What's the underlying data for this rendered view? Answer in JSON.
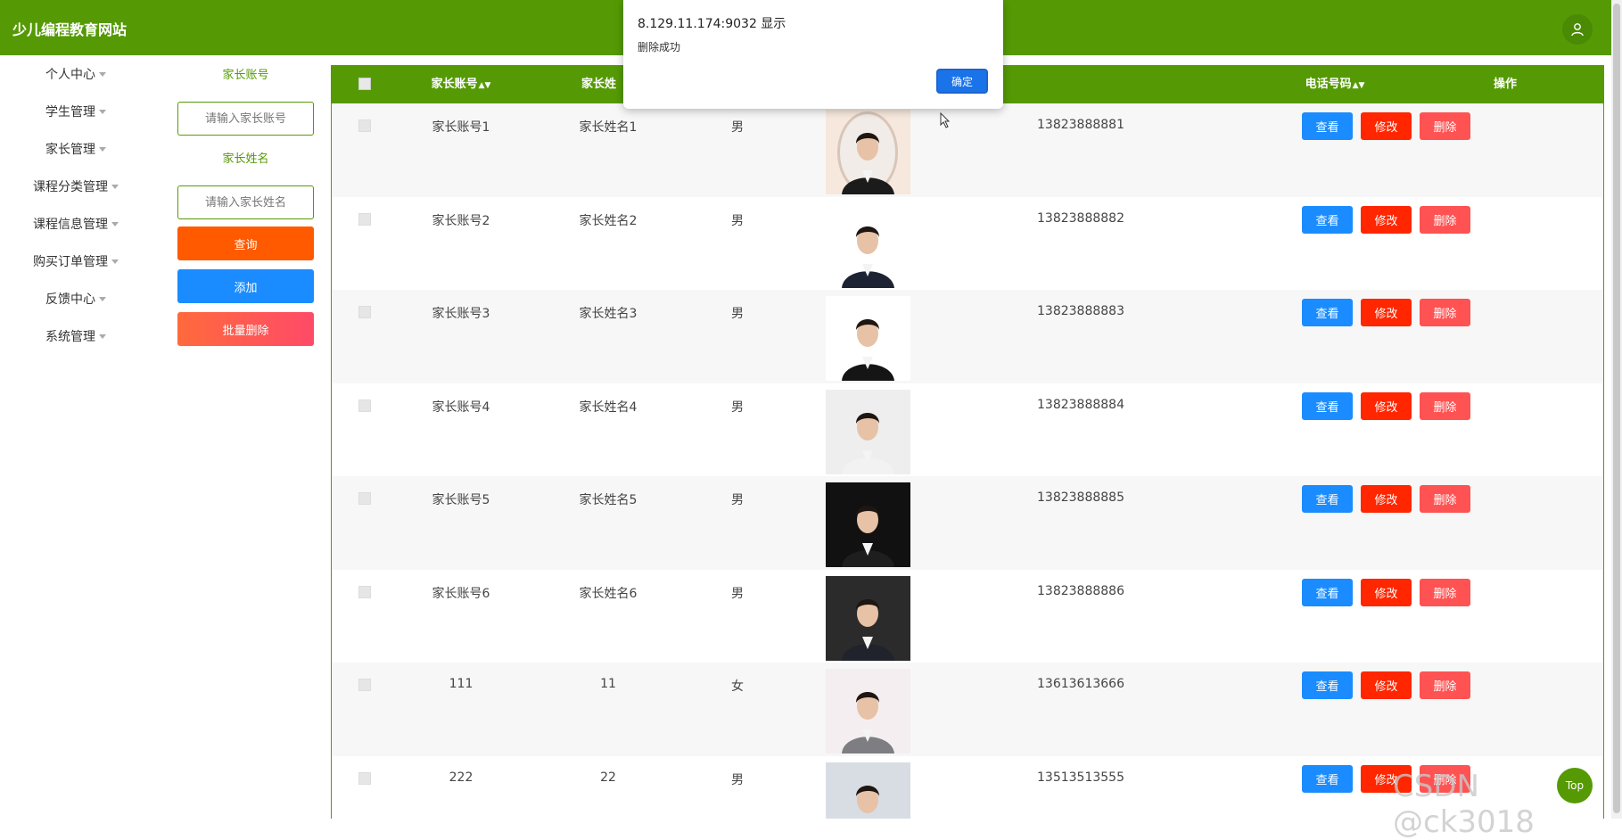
{
  "header": {
    "brand": "少儿编程教育网站"
  },
  "sidebar": {
    "items": [
      {
        "label": "个人中心"
      },
      {
        "label": "学生管理"
      },
      {
        "label": "家长管理"
      },
      {
        "label": "课程分类管理"
      },
      {
        "label": "课程信息管理"
      },
      {
        "label": "购买订单管理"
      },
      {
        "label": "反馈中心"
      },
      {
        "label": "系统管理"
      }
    ]
  },
  "search": {
    "account_label": "家长账号",
    "account_placeholder": "请输入家长账号",
    "name_label": "家长姓名",
    "name_placeholder": "请输入家长姓名",
    "query_label": "查询",
    "add_label": "添加",
    "batch_delete_label": "批量删除"
  },
  "table": {
    "headers": {
      "account": "家长账号",
      "name": "家长姓",
      "phone": "电话号码",
      "ops": "操作"
    },
    "rows": [
      {
        "account": "家长账号1",
        "name": "家长姓名1",
        "gender": "男",
        "phone": "13823888881"
      },
      {
        "account": "家长账号2",
        "name": "家长姓名2",
        "gender": "男",
        "phone": "13823888882"
      },
      {
        "account": "家长账号3",
        "name": "家长姓名3",
        "gender": "男",
        "phone": "13823888883"
      },
      {
        "account": "家长账号4",
        "name": "家长姓名4",
        "gender": "男",
        "phone": "13823888884"
      },
      {
        "account": "家长账号5",
        "name": "家长姓名5",
        "gender": "男",
        "phone": "13823888885"
      },
      {
        "account": "家长账号6",
        "name": "家长姓名6",
        "gender": "男",
        "phone": "13823888886"
      },
      {
        "account": "111",
        "name": "11",
        "gender": "女",
        "phone": "13613613666"
      },
      {
        "account": "222",
        "name": "22",
        "gender": "男",
        "phone": "13513513555"
      }
    ],
    "actions": {
      "view": "查看",
      "edit": "修改",
      "delete": "删除"
    }
  },
  "dialog": {
    "title": "8.129.11.174:9032 显示",
    "message": "删除成功",
    "ok_label": "确定"
  },
  "watermark": "CSDN @ck3018",
  "top_button": "Top",
  "colors": {
    "theme": "#559a05",
    "query": "#ff5a00",
    "add": "#1a8cff",
    "edit": "#ff2600",
    "delete": "#ff5252"
  }
}
